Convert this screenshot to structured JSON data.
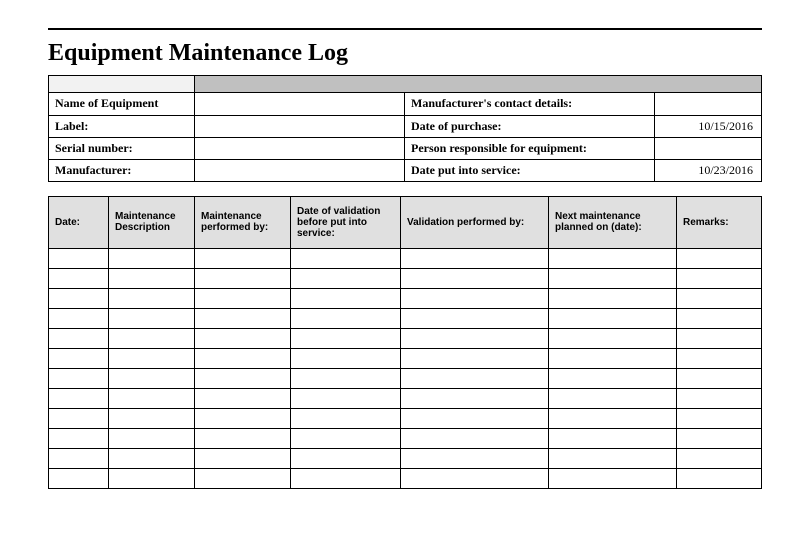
{
  "title": "Equipment Maintenance Log",
  "info": {
    "rows": [
      {
        "leftLabel": "Name of Equipment",
        "leftValue": "",
        "rightLabel": "Manufacturer's contact details:",
        "rightValue": ""
      },
      {
        "leftLabel": "Label:",
        "leftValue": "",
        "rightLabel": "Date of purchase:",
        "rightValue": "10/15/2016"
      },
      {
        "leftLabel": "Serial number:",
        "leftValue": "",
        "rightLabel": "Person responsible for equipment:",
        "rightValue": ""
      },
      {
        "leftLabel": "Manufacturer:",
        "leftValue": "",
        "rightLabel": "Date put into service:",
        "rightValue": "10/23/2016"
      }
    ]
  },
  "log": {
    "headers": [
      "Date:",
      "Maintenance Description",
      "Maintenance performed by:",
      "Date of validation before put into service:",
      "Validation performed by:",
      "Next maintenance planned on (date):",
      "Remarks:"
    ],
    "rowCount": 12
  }
}
